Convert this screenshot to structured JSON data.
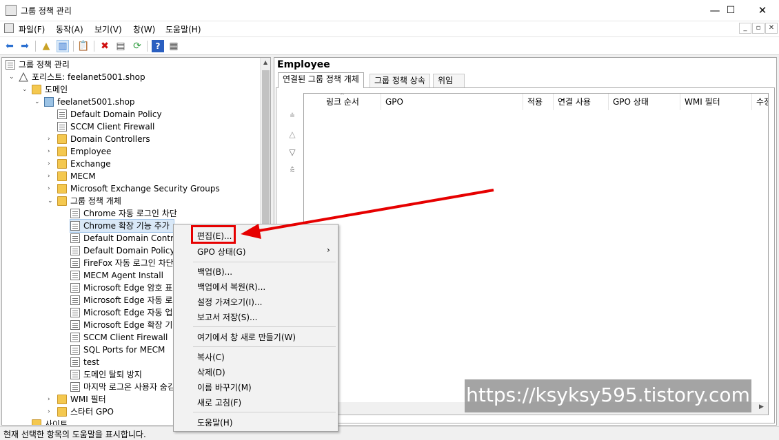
{
  "window": {
    "title": "그룹 정책 관리",
    "minimize": "—",
    "maximize": "☐",
    "close": "✕"
  },
  "menubar": {
    "items": [
      "파일(F)",
      "동작(A)",
      "보기(V)",
      "창(W)",
      "도움말(H)"
    ]
  },
  "tree": {
    "root": "그룹 정책 관리",
    "forest": "포리스트: feelanet5001.shop",
    "domains": "도메인",
    "domain": "feelanet5001.shop",
    "domain_children": [
      "Default Domain Policy",
      "SCCM Client Firewall",
      "Domain Controllers",
      "Employee",
      "Exchange",
      "MECM",
      "Microsoft Exchange Security Groups"
    ],
    "gpo_container": "그룹 정책 개체",
    "gpos": [
      "Chrome 자동 로그인 차단",
      "Chrome 확장 기능 추가",
      "Default Domain Controllers",
      "Default Domain Policy",
      "FireFox 자동 로그인 차단",
      "MECM Agent Install",
      "Microsoft Edge 암호 표시",
      "Microsoft Edge 자동 로그인",
      "Microsoft Edge 자동 업데이트",
      "Microsoft Edge 확장 기능",
      "SCCM Client Firewall",
      "SQL Ports for MECM",
      "test",
      "도메인 탈퇴 방지",
      "마지막 로그온 사용자 숨김"
    ],
    "wmi": "WMI 필터",
    "starter": "스타터 GPO",
    "sites": "사이트"
  },
  "right": {
    "title": "Employee",
    "tabs": [
      "연결된 그룹 정책 개체",
      "그룹 정책 상속",
      "위임"
    ],
    "columns": [
      "링크 순서",
      "GPO",
      "적용",
      "연결 사용",
      "GPO 상태",
      "WMI 필터",
      "수정"
    ]
  },
  "context_menu": {
    "items": [
      "편집(E)...",
      "GPO 상태(G)",
      "백업(B)...",
      "백업에서 복원(R)...",
      "설정 가져오기(I)...",
      "보고서 저장(S)...",
      "여기에서 창 새로 만들기(W)",
      "복사(C)",
      "삭제(D)",
      "이름 바꾸기(M)",
      "새로 고침(F)",
      "도움말(H)"
    ]
  },
  "status": "현재 선택한 항목의 도움말을 표시합니다.",
  "watermark": "https://ksyksy595.tistory.com",
  "colors": {
    "accent": "#e60000",
    "selection": "#d9e8f7"
  }
}
